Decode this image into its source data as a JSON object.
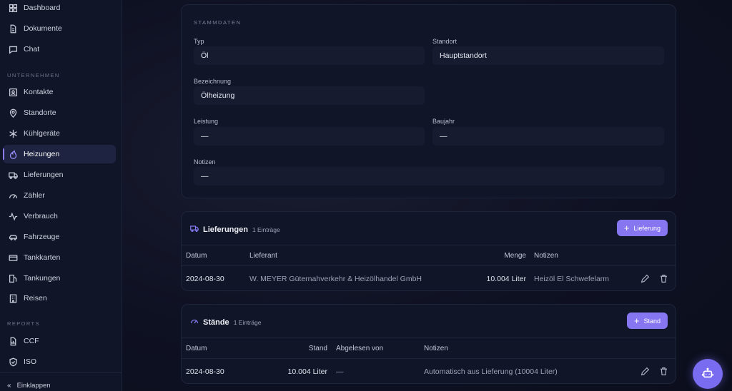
{
  "sidebar": {
    "top_items": [
      {
        "label": "Dashboard",
        "icon": "dashboard-icon"
      },
      {
        "label": "Dokumente",
        "icon": "document-icon"
      },
      {
        "label": "Chat",
        "icon": "chat-icon"
      }
    ],
    "section_unternehmen": "UNTERNEHMEN",
    "unternehmen_items": [
      {
        "label": "Kontakte",
        "icon": "contacts-icon"
      },
      {
        "label": "Standorte",
        "icon": "location-icon"
      },
      {
        "label": "Kühlgeräte",
        "icon": "snowflake-icon"
      },
      {
        "label": "Heizungen",
        "icon": "flame-icon",
        "active": true
      },
      {
        "label": "Lieferungen",
        "icon": "truck-icon"
      },
      {
        "label": "Zähler",
        "icon": "gauge-icon"
      },
      {
        "label": "Verbrauch",
        "icon": "activity-icon"
      },
      {
        "label": "Fahrzeuge",
        "icon": "car-icon"
      },
      {
        "label": "Tankkarten",
        "icon": "card-icon"
      },
      {
        "label": "Tankungen",
        "icon": "fuel-icon"
      },
      {
        "label": "Reisen",
        "icon": "building-icon"
      }
    ],
    "section_reports": "REPORTS",
    "reports_items": [
      {
        "label": "CCF",
        "icon": "report-icon"
      },
      {
        "label": "ISO",
        "icon": "shield-check-icon"
      }
    ],
    "collapse_label": "Einklappen"
  },
  "stammdaten": {
    "title": "STAMMDATEN",
    "typ_label": "Typ",
    "typ_value": "Öl",
    "standort_label": "Standort",
    "standort_value": "Hauptstandort",
    "bezeichnung_label": "Bezeichnung",
    "bezeichnung_value": "Ölheizung",
    "leistung_label": "Leistung",
    "leistung_value": "—",
    "baujahr_label": "Baujahr",
    "baujahr_value": "—",
    "notizen_label": "Notizen",
    "notizen_value": "—"
  },
  "lieferungen": {
    "title": "Lieferungen",
    "count": "1 Einträge",
    "add_label": "Lieferung",
    "columns": {
      "datum": "Datum",
      "lieferant": "Lieferant",
      "menge": "Menge",
      "notizen": "Notizen"
    },
    "rows": [
      {
        "datum": "2024-08-30",
        "lieferant": "W. MEYER Güternahverkehr & Heizölhandel GmbH",
        "menge": "10.004 Liter",
        "notizen": "Heizöl El Schwefelarm"
      }
    ]
  },
  "staende": {
    "title": "Stände",
    "count": "1 Einträge",
    "add_label": "Stand",
    "columns": {
      "datum": "Datum",
      "stand": "Stand",
      "abgelesen": "Abgelesen von",
      "notizen": "Notizen"
    },
    "rows": [
      {
        "datum": "2024-08-30",
        "stand": "10.004 Liter",
        "abgelesen": "—",
        "notizen": "Automatisch aus Lieferung (10004 Liter)"
      }
    ]
  },
  "colors": {
    "accent": "#8677f0",
    "background": "#0d1020",
    "card": "#101528"
  }
}
